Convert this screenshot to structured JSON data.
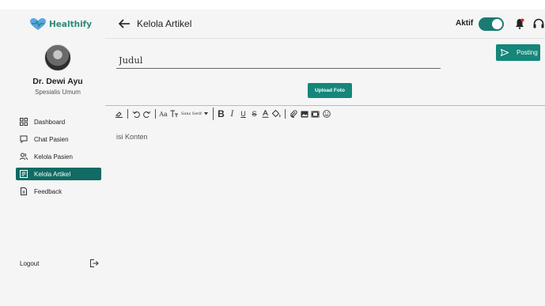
{
  "brand": {
    "name": "Healthify",
    "color": "#2a8a7a"
  },
  "user": {
    "name": "Dr. Dewi Ayu",
    "role": "Spesialis Umum"
  },
  "nav": [
    {
      "label": "Dashboard",
      "icon": "dashboard-icon",
      "active": false
    },
    {
      "label": "Chat Pasien",
      "icon": "chat-icon",
      "active": false
    },
    {
      "label": "Kelola Pasien",
      "icon": "users-icon",
      "active": false
    },
    {
      "label": "Kelola Artikel",
      "icon": "article-icon",
      "active": true
    },
    {
      "label": "Feedback",
      "icon": "feedback-icon",
      "active": false
    }
  ],
  "logout": {
    "label": "Logout",
    "icon": "logout-icon"
  },
  "header": {
    "title": "Kelola Artikel",
    "status_label": "Aktif",
    "status_on": true
  },
  "editor": {
    "title_placeholder": "Judul",
    "post_label": "Posting",
    "upload_label": "Upload Foto",
    "font_size_label": "Aa",
    "font_family": "Sans Serif",
    "content_placeholder": "isi Konten"
  },
  "colors": {
    "accent": "#14867a",
    "active_nav": "#116a63",
    "toggle": "#1b7b74"
  }
}
